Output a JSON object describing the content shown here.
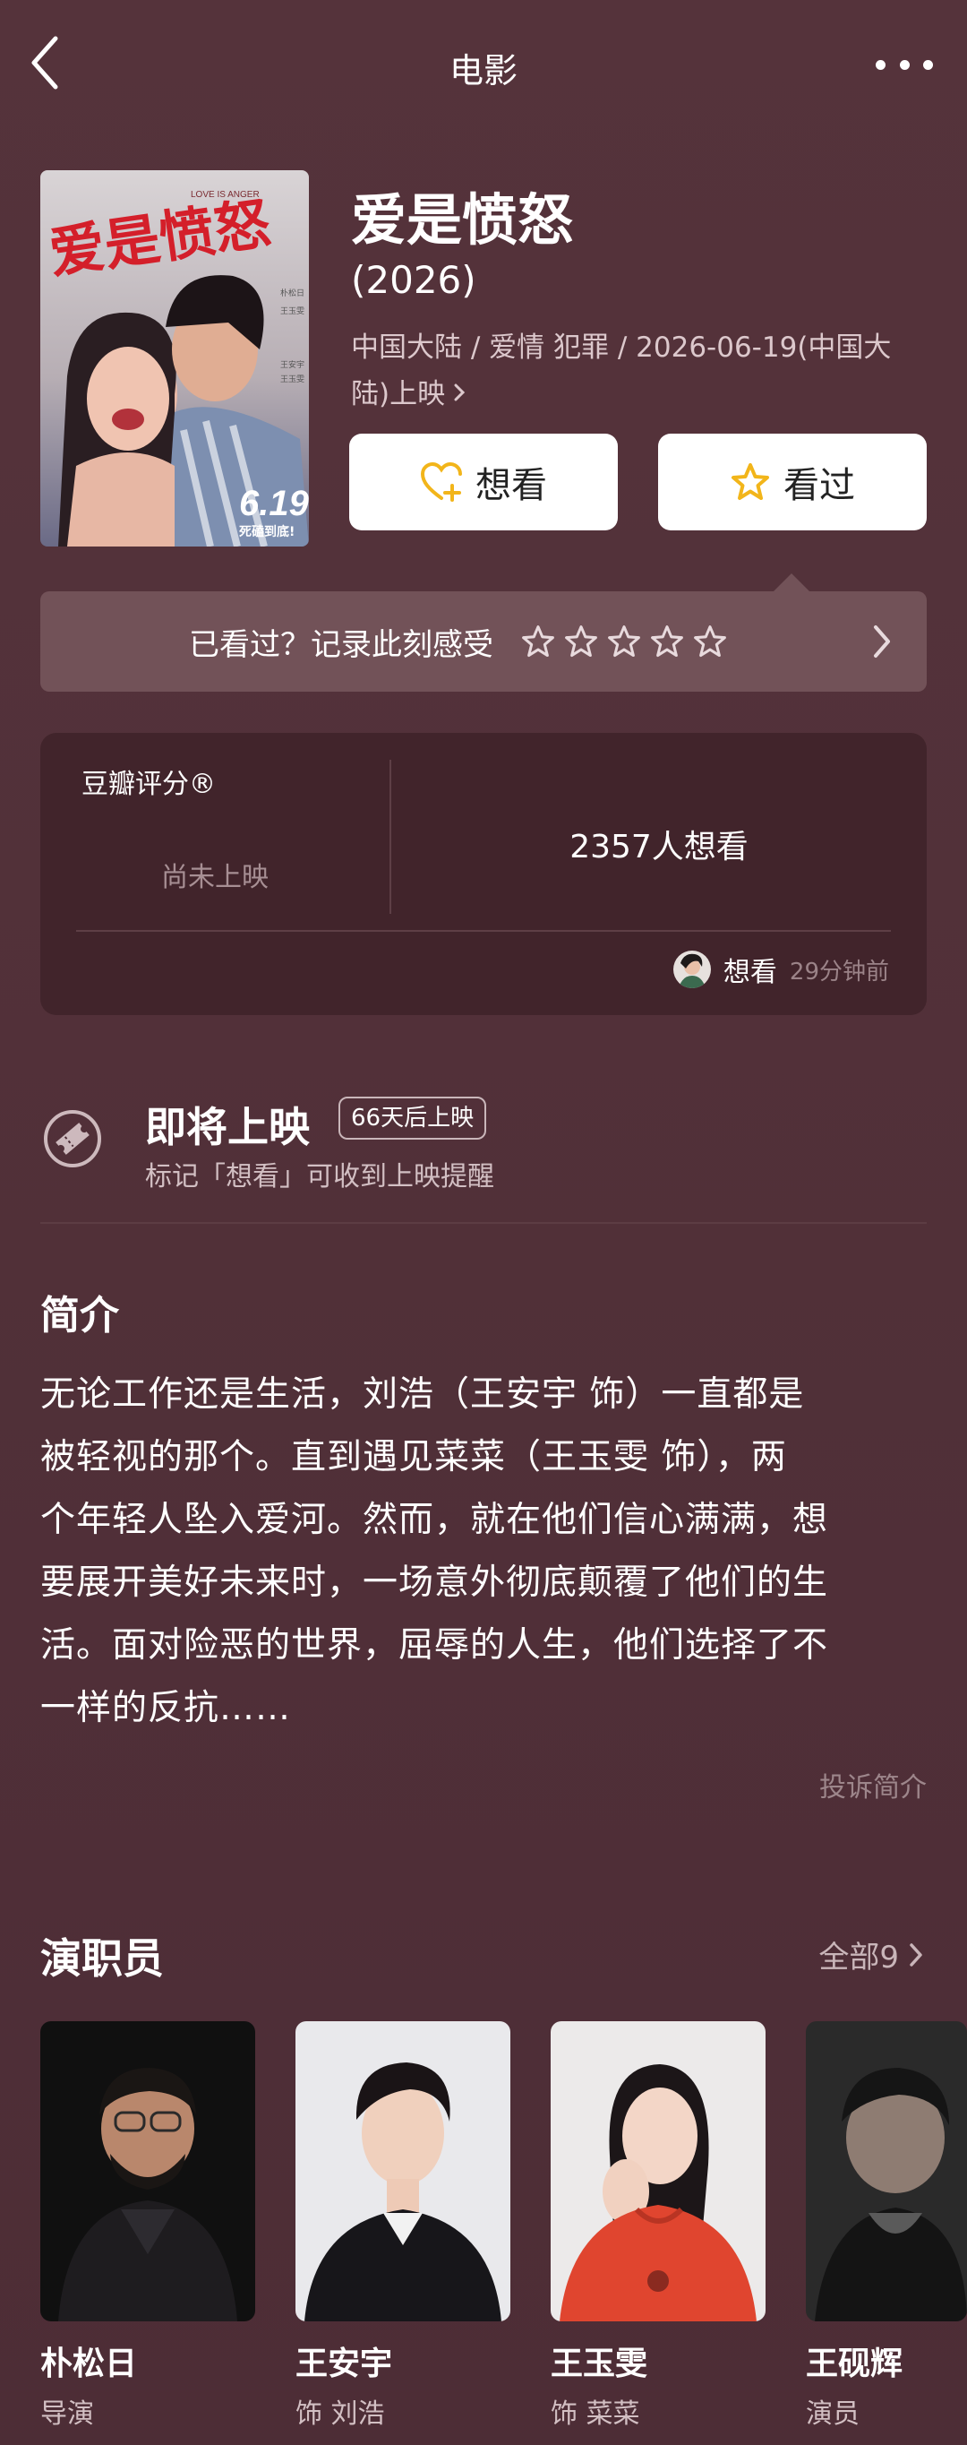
{
  "nav": {
    "title": "电影"
  },
  "movie": {
    "title": "爱是愤怒",
    "year": "(2026)",
    "meta_line1": "中国大陆 / 爱情 犯罪 / 2026-06-19(中国大",
    "meta_line2": "陆)上映",
    "poster": {
      "title_art": "爱是愤怒",
      "english": "LOVE IS ANGER",
      "release_date": "6.19",
      "tagline": "死磕到底!",
      "credits": [
        "朴松日",
        "王玉雯",
        "王安宇",
        "王玉雯"
      ]
    }
  },
  "actions": {
    "want_label": "想看",
    "seen_label": "看过"
  },
  "rate_prompt": {
    "text": "已看过？记录此刻感受",
    "stars_total": 5
  },
  "rating": {
    "label": "豆瓣评分®",
    "status": "尚未上映",
    "want_count": "2357人想看",
    "recent_action": "想看",
    "recent_time": "29分钟前"
  },
  "upcoming": {
    "title": "即将上映",
    "badge": "66天后上映",
    "subtitle": "标记「想看」可收到上映提醒"
  },
  "intro": {
    "title": "简介",
    "lines": [
      "无论工作还是生活，刘浩（王安宇 饰）一直都是",
      "被轻视的那个。直到遇见菜菜（王玉雯 饰），两",
      "个年轻人坠入爱河。然而，就在他们信心满满，想",
      "要展开美好未来时，一场意外彻底颠覆了他们的生",
      "活。面对险恶的世界，屈辱的人生，他们选择了不",
      "一样的反抗……"
    ],
    "report": "投诉简介"
  },
  "cast": {
    "title": "演职员",
    "all_label": "全部9",
    "members": [
      {
        "name": "朴松日",
        "role": "导演"
      },
      {
        "name": "王安宇",
        "role": "饰 刘浩"
      },
      {
        "name": "王玉雯",
        "role": "饰 菜菜"
      },
      {
        "name": "王砚辉",
        "role": "演员"
      }
    ]
  },
  "colors": {
    "background": "#4d2d36",
    "card": "#41242b",
    "rate_bar": "#725258",
    "star_accent": "#f2b51a"
  }
}
